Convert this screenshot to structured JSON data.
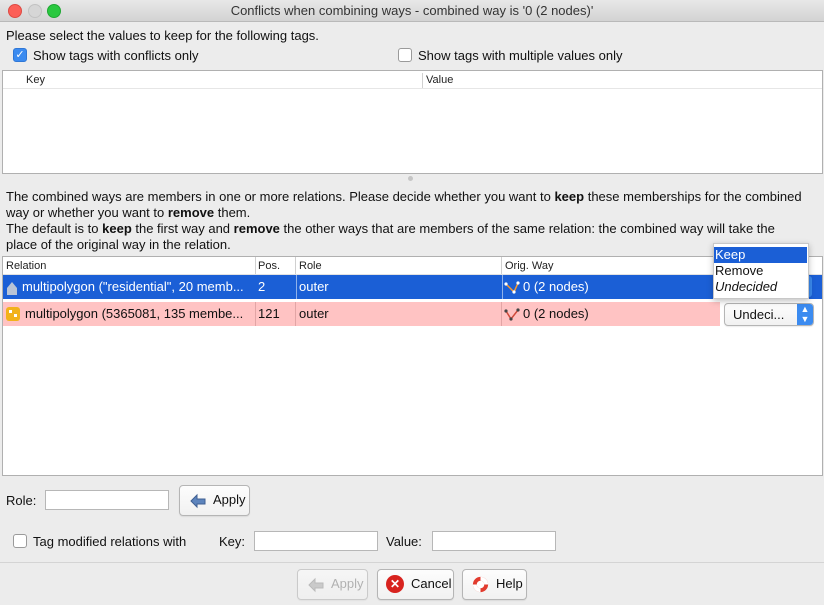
{
  "window": {
    "title": "Conflicts when combining ways - combined way is '0 (2 nodes)'"
  },
  "tags": {
    "instruction": "Please select the values to keep for the following tags.",
    "show_conflicts_label": "Show tags with conflicts only",
    "show_conflicts_checked": true,
    "show_multiple_label": "Show tags with multiple values only",
    "show_multiple_checked": false,
    "columns": {
      "key": "Key",
      "value": "Value"
    }
  },
  "relations": {
    "description_parts": [
      "The combined ways are members in one or more relations. Please decide whether you want to ",
      "keep",
      " these memberships for the combined",
      "way or whether you want to ",
      "remove",
      " them.",
      "The default is to ",
      "keep",
      " the first way and ",
      "remove",
      " the other ways that are members of the same relation: the combined way will take the",
      "place of the original way in the relation."
    ],
    "columns": {
      "relation": "Relation",
      "pos": "Pos.",
      "role": "Role",
      "orig_way": "Orig. Way"
    },
    "rows": [
      {
        "relation": "multipolygon (\"residential\", 20 memb...",
        "pos": "2",
        "role": "outer",
        "orig_way": "0 (2 nodes)"
      },
      {
        "relation": "multipolygon (5365081, 135 membe...",
        "pos": "121",
        "role": "outer",
        "orig_way": "0 (2 nodes)",
        "decision": "Undeci..."
      }
    ],
    "dropdown_options": [
      "Keep",
      "Remove",
      "Undecided"
    ]
  },
  "role_editor": {
    "label": "Role:",
    "value": "",
    "apply_label": "Apply"
  },
  "tag_modified": {
    "checkbox_label": "Tag modified relations with",
    "checked": false,
    "key_label": "Key:",
    "key_value": "",
    "value_label": "Value:",
    "value_value": ""
  },
  "footer": {
    "apply_label": "Apply",
    "cancel_label": "Cancel",
    "help_label": "Help"
  },
  "colors": {
    "selection": "#1b5fd6",
    "conflict_row": "#ffc3c3",
    "accent": "#3b8bf0"
  }
}
